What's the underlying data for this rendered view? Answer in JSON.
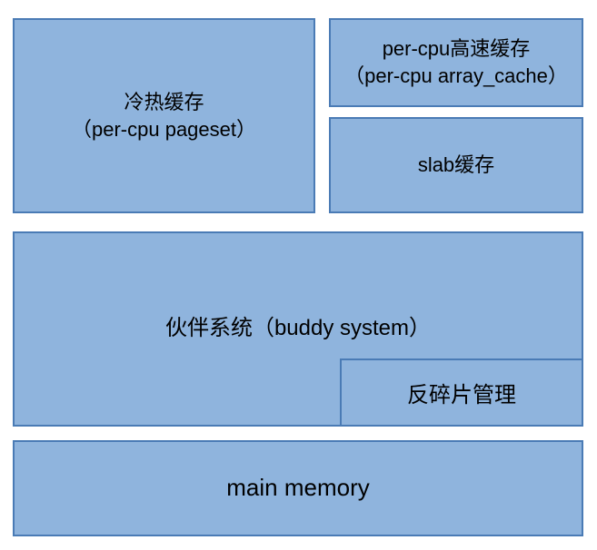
{
  "boxes": {
    "cold_hot_cache": {
      "line1": "冷热缓存",
      "line2": "（per-cpu pageset）"
    },
    "per_cpu_cache": {
      "line1": "per-cpu高速缓存",
      "line2": "（per-cpu array_cache）"
    },
    "slab_cache": "slab缓存",
    "buddy_system": "伙伴系统（buddy system）",
    "anti_frag": "反碎片管理",
    "main_memory": "main memory"
  },
  "colors": {
    "fill": "#8fb4dd",
    "border": "#4a7bb5"
  }
}
